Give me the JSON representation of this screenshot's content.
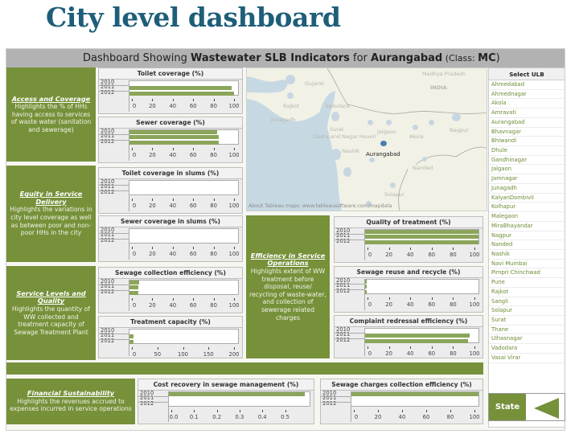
{
  "page_title": "City level dashboard",
  "header": {
    "prefix": "Dashboard Showing ",
    "indicators": "Wastewater SLB Indicators",
    "for": " for ",
    "city": "Aurangabad",
    "class_prefix": " (Class: ",
    "class_value": "MC",
    "class_suffix": ")"
  },
  "colors": {
    "panel_green": "#76913a",
    "bar_green": "#8ba55a",
    "title_blue": "#1e5e79",
    "header_gray": "#b2b2b2",
    "selected_city_dot": "#4b7fae"
  },
  "panels": {
    "access": {
      "title": "Access and Coverage",
      "desc": "Highlights the % of HHs having access to services of waste water (sanitation and sewerage)"
    },
    "equity": {
      "title": "Equity in Service Delivery",
      "desc": "Highlights the variations in city level coverage as well as between poor and non-poor HHs in the city"
    },
    "service": {
      "title": "Service Levels and Quality",
      "desc": "Highlights the quantity of WW collected and treatment capacity of Sewage Treatment Plant"
    },
    "efficiency": {
      "title": "Efficiency in Service Operations",
      "desc": "Highlights extent of WW treatment before disposal, reuse/ recycling of waste-water, and collection of sewerage related charges"
    },
    "financial": {
      "title": "Financial Sustainability",
      "desc": "Highlights the revenues accrued to expenses incurred in service operations"
    }
  },
  "map": {
    "region_labels": [
      "Madhya Pradesh",
      "INDIA",
      "Gujarat"
    ],
    "city_labels": [
      "Rajkot",
      "Vadodara",
      "Junagadh",
      "Surat",
      "Dadra and Nagar Haveli",
      "Jalgaon",
      "Akola",
      "Nagpur",
      "Nashik",
      "Nanded",
      "Solapur"
    ],
    "selected_city": "Aurangabad",
    "attribution": "About Tableau maps: www.tableausoftware.com/mapdata"
  },
  "ulb_selector": {
    "header": "Select ULB",
    "items": [
      "Ahmedabad",
      "Ahmednagar",
      "Akola",
      "Amravati",
      "Aurangabad",
      "Bhavnagar",
      "Bhiwandi",
      "Dhule",
      "Gandhinagar",
      "Jalgaon",
      "Jamnagar",
      "Junagadh",
      "KalyanDombivli",
      "Kolhapur",
      "Malegaon",
      "MiraBhayandar",
      "Nagpur",
      "Nanded",
      "Nashik",
      "Navi Mumbai",
      "Pimpri Chinchwad",
      "Pune",
      "Rajkot",
      "Sangli",
      "Solapur",
      "Surat",
      "Thane",
      "Ulhasnagar",
      "Vadodara",
      "Vasai Virar"
    ]
  },
  "state_button": {
    "label": "State"
  },
  "chart_data": [
    {
      "id": "toilet",
      "type": "bar",
      "orientation": "horizontal",
      "title": "Toilet coverage (%)",
      "categories": [
        "2010",
        "2011",
        "2012"
      ],
      "values": [
        null,
        94,
        96
      ],
      "xlim": [
        0,
        100
      ],
      "ticks": [
        0,
        20,
        40,
        60,
        80,
        100
      ]
    },
    {
      "id": "sewer",
      "type": "bar",
      "orientation": "horizontal",
      "title": "Sewer coverage (%)",
      "categories": [
        "2010",
        "2011",
        "2012"
      ],
      "values": [
        81,
        82,
        82
      ],
      "xlim": [
        0,
        100
      ],
      "ticks": [
        0,
        20,
        40,
        60,
        80,
        100
      ]
    },
    {
      "id": "toilet_slums",
      "type": "bar",
      "orientation": "horizontal",
      "title": "Toilet coverage in slums (%)",
      "categories": [
        "2010",
        "2011",
        "2012"
      ],
      "values": [
        null,
        null,
        null
      ],
      "xlim": [
        0,
        100
      ],
      "ticks": [
        0,
        20,
        40,
        60,
        80,
        100
      ]
    },
    {
      "id": "sewer_slums",
      "type": "bar",
      "orientation": "horizontal",
      "title": "Sewer coverage in slums (%)",
      "categories": [
        "2010",
        "2011",
        "2012"
      ],
      "values": [
        null,
        null,
        null
      ],
      "xlim": [
        0,
        100
      ],
      "ticks": [
        0,
        20,
        40,
        60,
        80,
        100
      ]
    },
    {
      "id": "collection",
      "type": "bar",
      "orientation": "horizontal",
      "title": "Sewage collection efficiency (%)",
      "categories": [
        "2010",
        "2011",
        "2012"
      ],
      "values": [
        9,
        8,
        8
      ],
      "xlim": [
        0,
        100
      ],
      "ticks": [
        0,
        20,
        40,
        60,
        80,
        100
      ]
    },
    {
      "id": "treatment_cap",
      "type": "bar",
      "orientation": "horizontal",
      "title": "Treatment capacity (%)",
      "categories": [
        "2010",
        "2011",
        "2012"
      ],
      "values": [
        null,
        8,
        7
      ],
      "xlim": [
        0,
        200
      ],
      "ticks": [
        0,
        50,
        100,
        150,
        200
      ]
    },
    {
      "id": "quality",
      "type": "bar",
      "orientation": "horizontal",
      "title": "Quality of treatment (%)",
      "categories": [
        "2010",
        "2011",
        "2012"
      ],
      "values": [
        100,
        100,
        100
      ],
      "xlim": [
        0,
        100
      ],
      "ticks": [
        0,
        20,
        40,
        60,
        80,
        100
      ]
    },
    {
      "id": "reuse",
      "type": "bar",
      "orientation": "horizontal",
      "title": "Sewage reuse and recycle (%)",
      "categories": [
        "2010",
        "2011",
        "2012"
      ],
      "values": [
        0.5,
        0.5,
        0.5
      ],
      "xlim": [
        0,
        100
      ],
      "ticks": [
        0,
        20,
        40,
        60,
        80,
        100
      ]
    },
    {
      "id": "complaint",
      "type": "bar",
      "orientation": "horizontal",
      "title": "Complaint redressal efficiency (%)",
      "categories": [
        "2010",
        "2011",
        "2012"
      ],
      "values": [
        null,
        92,
        91
      ],
      "xlim": [
        0,
        100
      ],
      "ticks": [
        0,
        20,
        40,
        60,
        80,
        100
      ]
    },
    {
      "id": "cost_recovery",
      "type": "bar",
      "orientation": "horizontal",
      "title": "Cost recovery in sewage management (%)",
      "categories": [
        "2010",
        "2011",
        "2012"
      ],
      "values": [
        0.57,
        null,
        null
      ],
      "xlim": [
        0,
        0.59
      ],
      "ticks": [
        0.0,
        0.1,
        0.2,
        0.3,
        0.4,
        0.5
      ],
      "tick_labels": [
        "0.0",
        "0.1",
        "0.2",
        "0.3",
        "0.4",
        "0.5"
      ]
    },
    {
      "id": "charges_collection",
      "type": "bar",
      "orientation": "horizontal",
      "title": "Sewage charges collection efficiency (%)",
      "categories": [
        "2010",
        "2011",
        "2012"
      ],
      "values": [
        100,
        null,
        null
      ],
      "xlim": [
        0,
        100
      ],
      "ticks": [
        0,
        20,
        40,
        60,
        80,
        100
      ]
    }
  ]
}
